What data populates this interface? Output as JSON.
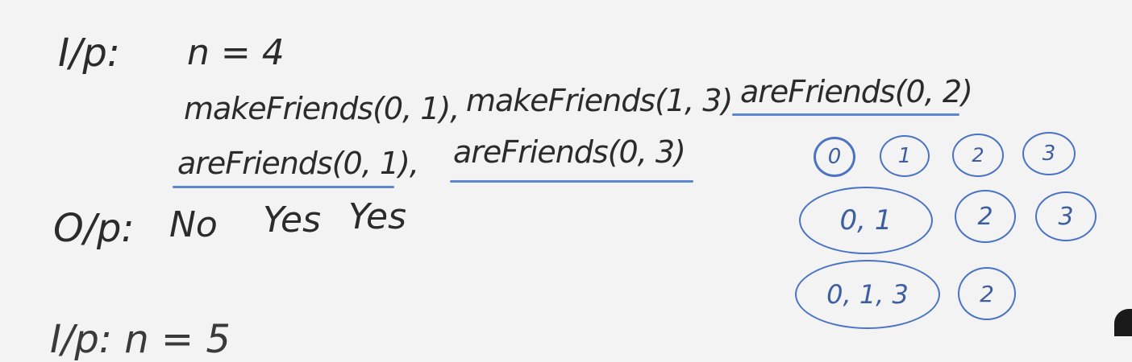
{
  "input": {
    "label": "I/p:",
    "n_expr": "n = 4",
    "line2": [
      "makeFriends(0, 1),",
      "makeFriends(1, 3)",
      "areFriends(0, 2)"
    ],
    "line3": [
      "areFriends(0, 1),",
      "areFriends(0, 3)"
    ]
  },
  "output": {
    "label": "O/p:",
    "values": [
      "No",
      "Yes",
      "Yes"
    ]
  },
  "sets": [
    [
      "0",
      "1",
      "2",
      "3"
    ],
    [
      "0, 1",
      "2",
      "3"
    ],
    [
      "0, 1, 3",
      "2"
    ]
  ],
  "partial_text": "I/p: n = 5",
  "colors": {
    "ink": "#2b2b2b",
    "blue": "#4a73c4"
  }
}
